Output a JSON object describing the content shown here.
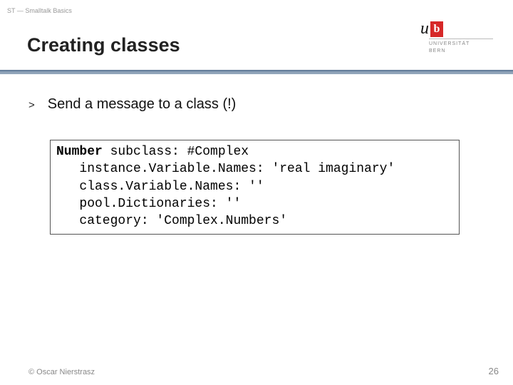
{
  "header": {
    "breadcrumb": "ST — Smalltalk Basics"
  },
  "title": "Creating classes",
  "logo": {
    "u": "u",
    "b": "b",
    "line1": "UNIVERSITÄT",
    "line2": "BERN"
  },
  "bullet": {
    "marker": ">",
    "text": "Send a message to a class (!)"
  },
  "code": {
    "l1a": "Number",
    "l1b": " subclass: #Complex",
    "l2": "   instance.Variable.Names: 'real imaginary'",
    "l3": "   class.Variable.Names: ''",
    "l4": "   pool.Dictionaries: ''",
    "l5": "   category: 'Complex.Numbers'"
  },
  "footer": {
    "left": "© Oscar Nierstrasz",
    "right": "26"
  }
}
